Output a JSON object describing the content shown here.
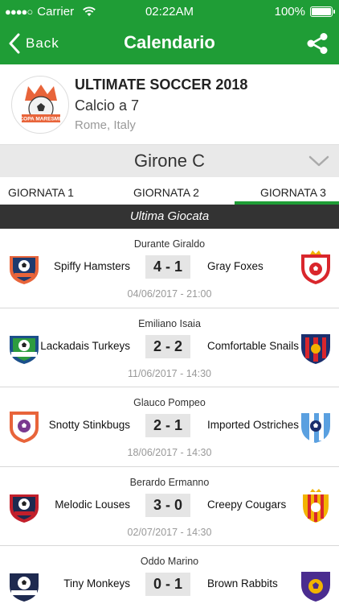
{
  "status_bar": {
    "signal": "●●●●○",
    "carrier": "Carrier",
    "time": "02:22AM",
    "battery": "100%"
  },
  "nav": {
    "back_label": "Back",
    "title": "Calendario"
  },
  "tournament": {
    "name": "ULTIMATE SOCCER 2018",
    "type": "Calcio a 7",
    "location": "Rome, Italy",
    "logo_text": "COPA MARESME"
  },
  "group": {
    "label": "Girone C"
  },
  "tabs": [
    {
      "label": "GIORNATA 1"
    },
    {
      "label": "GIORNATA 2"
    },
    {
      "label": "GIORNATA 3",
      "active": true
    }
  ],
  "section": {
    "label": "Ultima Giocata"
  },
  "matches": [
    {
      "referee": "Durante Giraldo",
      "home": "Spiffy Hamsters",
      "score": "4 - 1",
      "away": "Gray Foxes",
      "date": "04/06/2017 - 21:00",
      "home_crest": "fc-united-crest-icon",
      "away_crest": "red-shield-crest-icon"
    },
    {
      "referee": "Emiliano Isaia",
      "home": "Lackadais Turkeys",
      "score": "2 - 2",
      "away": "Comfortable Snails",
      "date": "11/06/2017 - 14:30",
      "home_crest": "soccer-crest-icon",
      "away_crest": "striped-shield-crest-icon"
    },
    {
      "referee": "Glauco Pompeo",
      "home": "Snotty Stinkbugs",
      "score": "2 - 1",
      "away": "Imported Ostriches",
      "date": "18/06/2017 - 14:30",
      "home_crest": "shield-ball-crest-icon",
      "away_crest": "blue-white-shield-crest-icon"
    },
    {
      "referee": "Berardo Ermanno",
      "home": "Melodic Louses",
      "score": "3 - 0",
      "away": "Creepy Cougars",
      "date": "02/07/2017 - 14:30",
      "home_crest": "fc-united-crest-icon",
      "away_crest": "yellow-red-crest-icon"
    },
    {
      "referee": "Oddo Marino",
      "home": "Tiny Monkeys",
      "score": "0 - 1",
      "away": "Brown Rabbits",
      "date": "",
      "home_crest": "soccer-club-crest-icon",
      "away_crest": "purple-shield-crest-icon"
    }
  ],
  "colors": {
    "brand_green": "#1f9d36",
    "dark_bar": "#333333",
    "score_bg": "#e5e5e5"
  }
}
